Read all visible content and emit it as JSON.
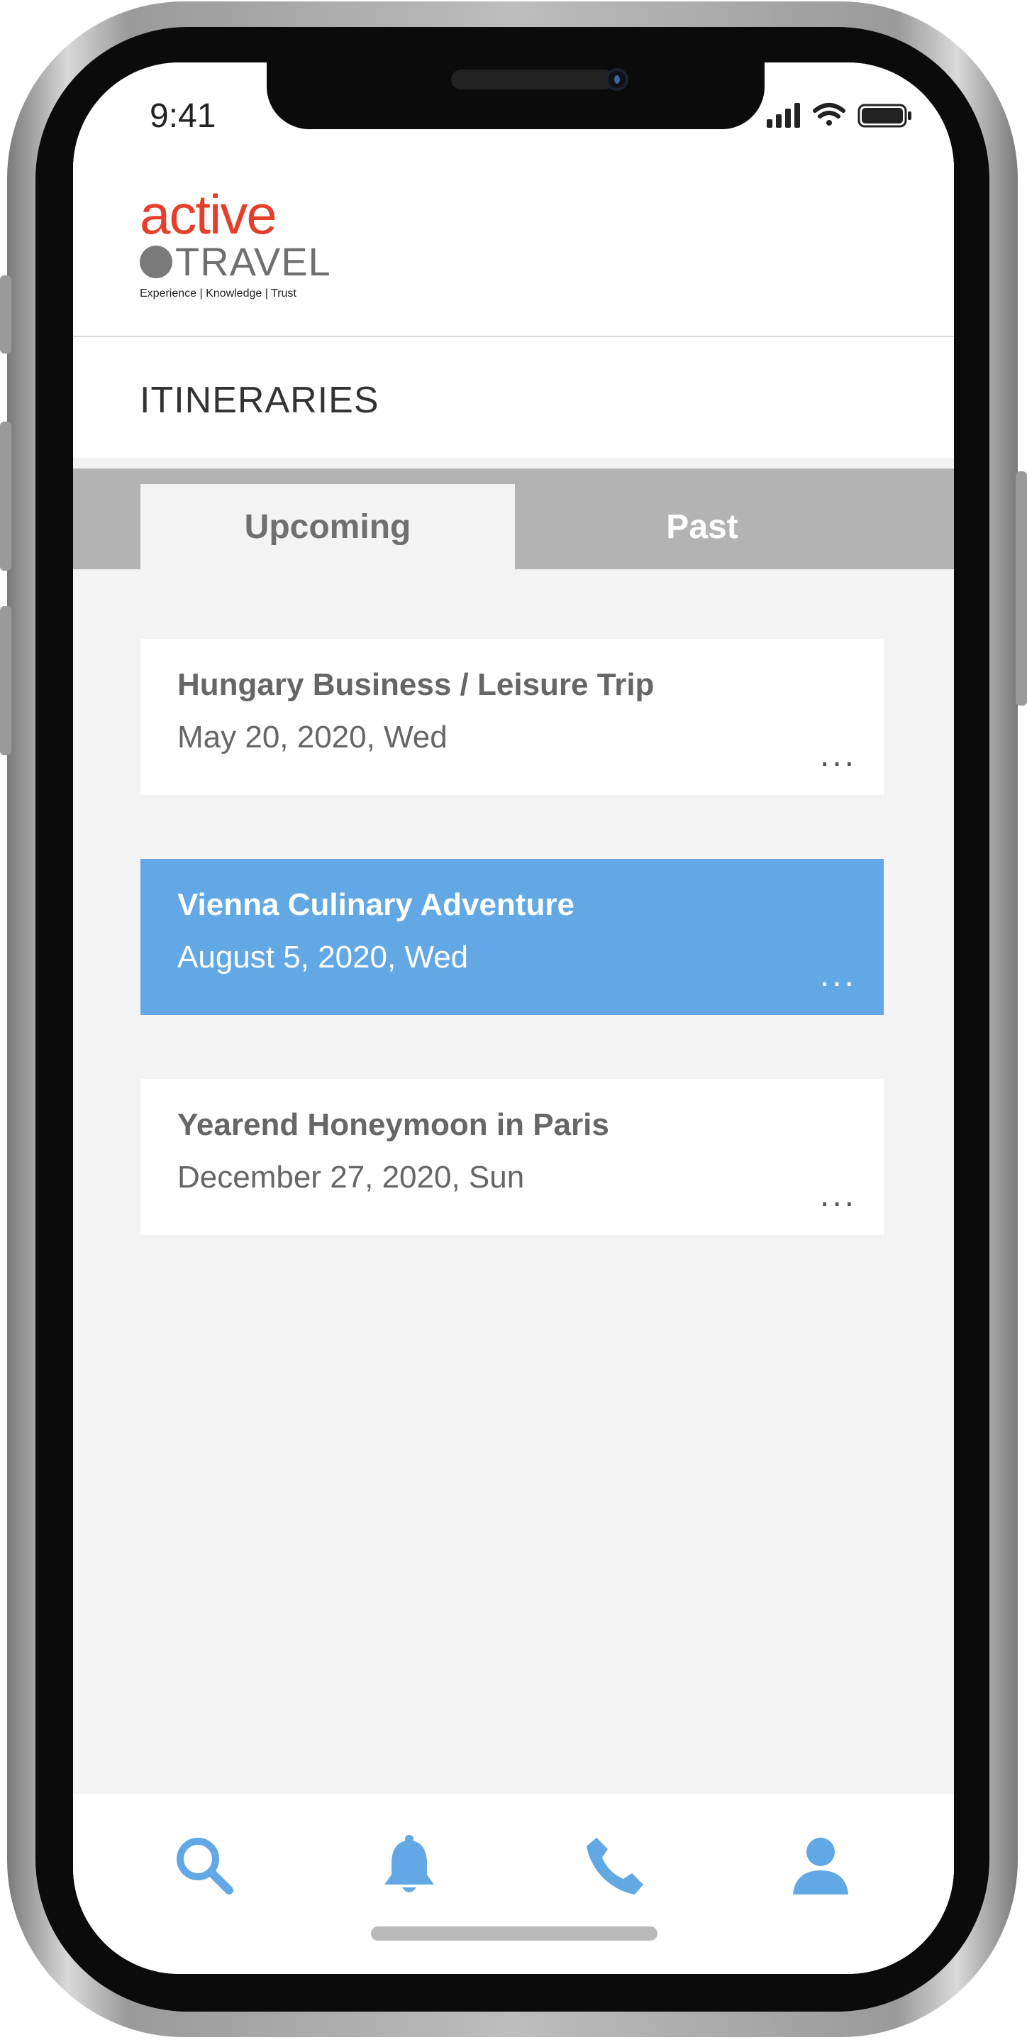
{
  "status_bar": {
    "time": "9:41"
  },
  "logo": {
    "line1": "active",
    "line2": "TRAVEL",
    "tagline": "Experience | Knowledge | Trust"
  },
  "page": {
    "title": "ITINERARIES"
  },
  "tabs": [
    {
      "label": "Upcoming",
      "active": true
    },
    {
      "label": "Past",
      "active": false
    }
  ],
  "itineraries": [
    {
      "title": "Hungary Business / Leisure Trip",
      "date": "May 20, 2020, Wed",
      "more": "...",
      "selected": false
    },
    {
      "title": "Vienna Culinary Adventure",
      "date": "August 5, 2020, Wed",
      "more": "...",
      "selected": true
    },
    {
      "title": "Yearend Honeymoon in Paris",
      "date": "December 27, 2020, Sun",
      "more": "...",
      "selected": false
    }
  ],
  "bottom_nav": [
    {
      "icon": "search-icon"
    },
    {
      "icon": "bell-icon"
    },
    {
      "icon": "phone-icon"
    },
    {
      "icon": "user-icon"
    }
  ],
  "colors": {
    "accent": "#62a8e4",
    "brand_red": "#e53e2a",
    "tab_bar": "#b3b3b3"
  }
}
